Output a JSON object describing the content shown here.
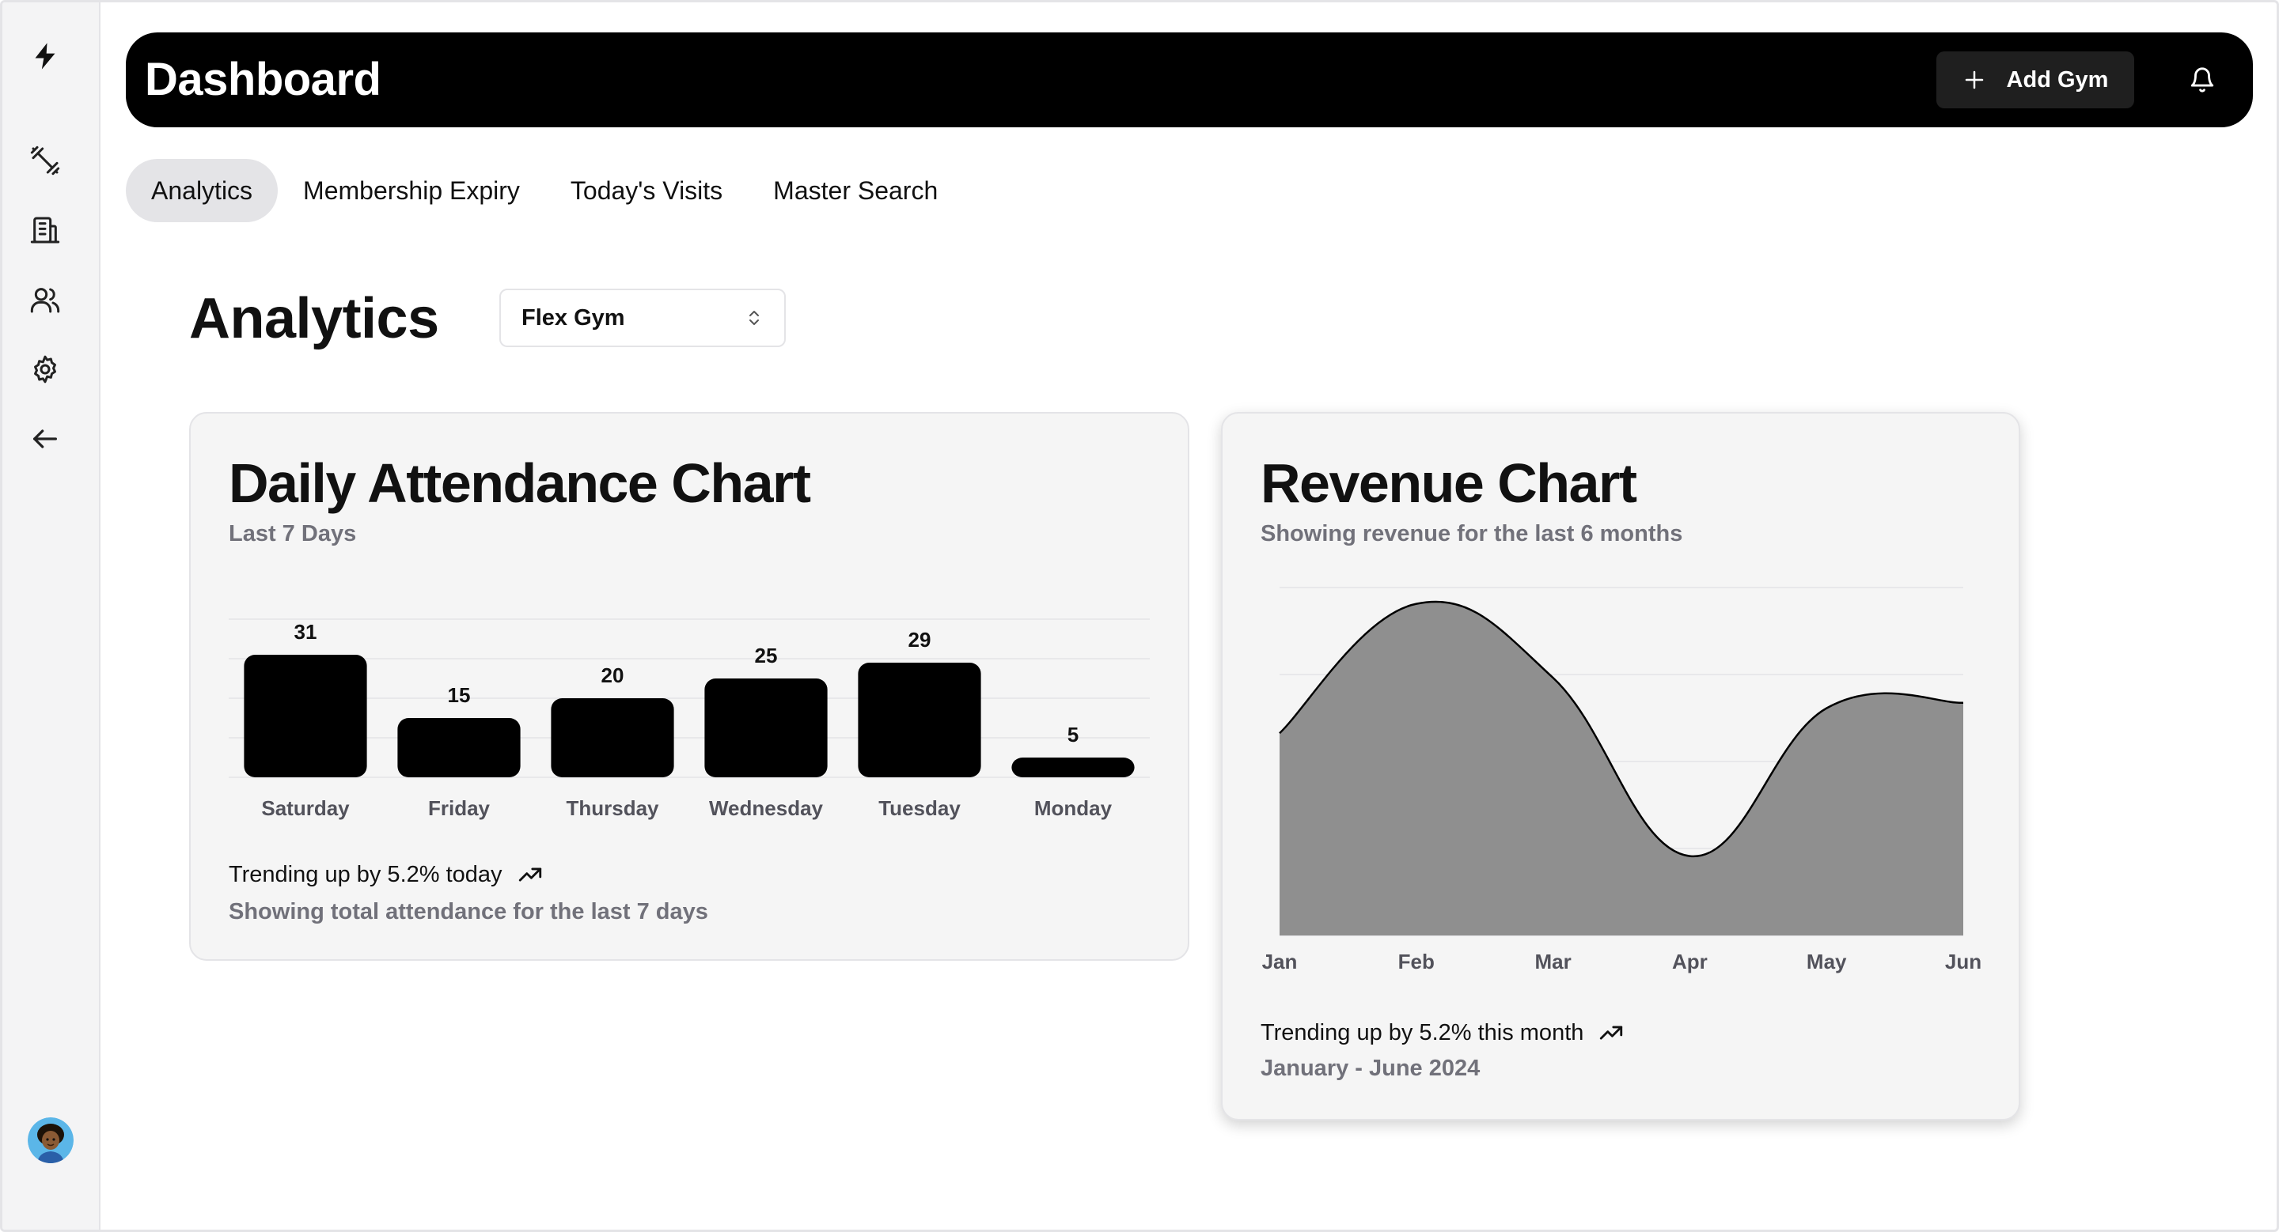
{
  "header": {
    "title": "Dashboard",
    "add_gym_label": "Add Gym"
  },
  "sidebar": {
    "items": [
      {
        "icon": "bolt-logo-icon"
      },
      {
        "icon": "dumbbell-icon"
      },
      {
        "icon": "building-icon"
      },
      {
        "icon": "users-icon"
      },
      {
        "icon": "gear-icon"
      },
      {
        "icon": "arrow-left-icon"
      }
    ]
  },
  "tabs": [
    {
      "label": "Analytics",
      "active": true
    },
    {
      "label": "Membership Expiry",
      "active": false
    },
    {
      "label": "Today's Visits",
      "active": false
    },
    {
      "label": "Master Search",
      "active": false
    }
  ],
  "page": {
    "title": "Analytics",
    "gym_select_value": "Flex Gym"
  },
  "attendance_card": {
    "title": "Daily Attendance Chart",
    "subtitle": "Last 7 Days",
    "trend": "Trending up by 5.2% today",
    "footnote": "Showing total attendance for the last 7 days"
  },
  "revenue_card": {
    "title": "Revenue Chart",
    "subtitle": "Showing revenue for the last 6 months",
    "trend": "Trending up by 5.2% this month",
    "footnote": "January - June 2024"
  },
  "colors": {
    "bar_fill": "#000000",
    "area_fill": "#8f8f8f",
    "area_stroke": "#000000",
    "header_bg": "#000000",
    "card_bg": "#f5f5f5"
  },
  "chart_data": [
    {
      "type": "bar",
      "categories": [
        "Saturday",
        "Friday",
        "Thursday",
        "Wednesday",
        "Tuesday",
        "Monday"
      ],
      "values": [
        31,
        15,
        20,
        25,
        29,
        5
      ],
      "title": "Daily Attendance Chart",
      "subtitle": "Last 7 Days",
      "ylim": [
        0,
        40
      ],
      "data_labels": true,
      "grid": true
    },
    {
      "type": "area",
      "categories": [
        "Jan",
        "Feb",
        "Mar",
        "Apr",
        "May",
        "Jun"
      ],
      "values": [
        186,
        305,
        237,
        73,
        209,
        214
      ],
      "title": "Revenue Chart",
      "subtitle": "Showing revenue for the last 6 months",
      "ylim": [
        0,
        320
      ],
      "grid": true,
      "smooth": true
    }
  ]
}
